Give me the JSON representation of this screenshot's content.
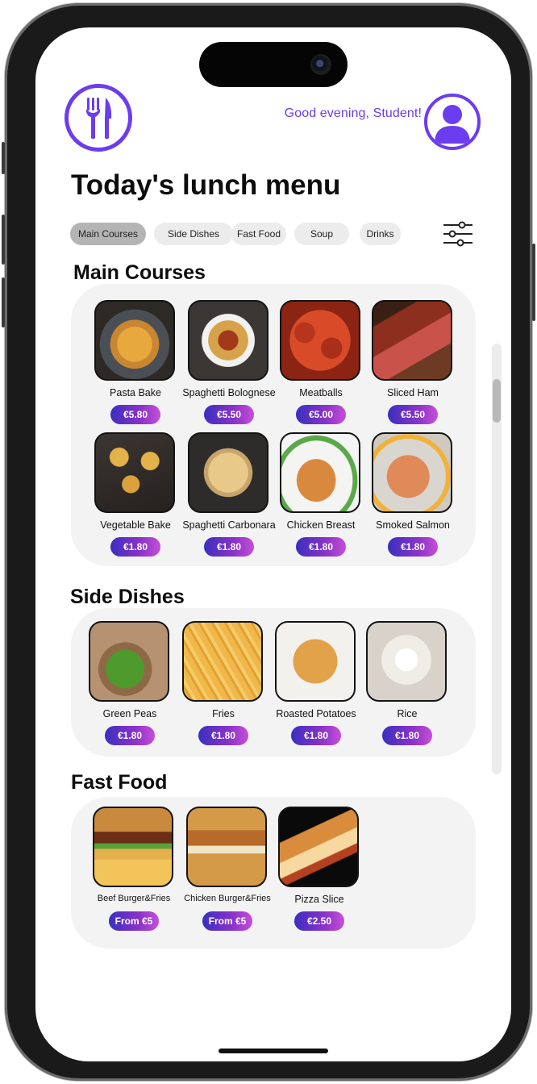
{
  "header": {
    "greeting": "Good evening, Student!",
    "logo_icon": "fork-knife-icon",
    "avatar_icon": "user-icon"
  },
  "page_title": "Today's lunch menu",
  "tabs": [
    "Main Courses",
    "Side Dishes",
    "Fast Food",
    "Soup",
    "Drinks"
  ],
  "active_tab": "Main Courses",
  "sections": [
    {
      "title": "Main Courses",
      "items": [
        {
          "name": "Pasta Bake",
          "price": "€5.80"
        },
        {
          "name": "Spaghetti Bolognese",
          "price": "€5.50"
        },
        {
          "name": "Meatballs",
          "price": "€5.00"
        },
        {
          "name": "Sliced Ham",
          "price": "€5.50"
        },
        {
          "name": "Vegetable Bake",
          "price": "€1.80"
        },
        {
          "name": "Spaghetti Carbonara",
          "price": "€1.80"
        },
        {
          "name": "Chicken Breast",
          "price": "€1.80"
        },
        {
          "name": "Smoked Salmon",
          "price": "€1.80"
        }
      ]
    },
    {
      "title": "Side Dishes",
      "items": [
        {
          "name": "Green Peas",
          "price": "€1.80"
        },
        {
          "name": "Fries",
          "price": "€1.80"
        },
        {
          "name": "Roasted Potatoes",
          "price": "€1.80"
        },
        {
          "name": "Rice",
          "price": "€1.80"
        }
      ]
    },
    {
      "title": "Fast Food",
      "items": [
        {
          "name": "Beef Burger&Fries",
          "price": "From €5"
        },
        {
          "name": "Chicken Burger&Fries",
          "price": "From €5"
        },
        {
          "name": "Pizza Slice",
          "price": "€2.50"
        }
      ]
    }
  ],
  "colors": {
    "accent": "#6b3cf0",
    "price_gradient_start": "#3a2fc0",
    "price_gradient_end": "#c64fd6",
    "panel": "#f3f3f3"
  }
}
